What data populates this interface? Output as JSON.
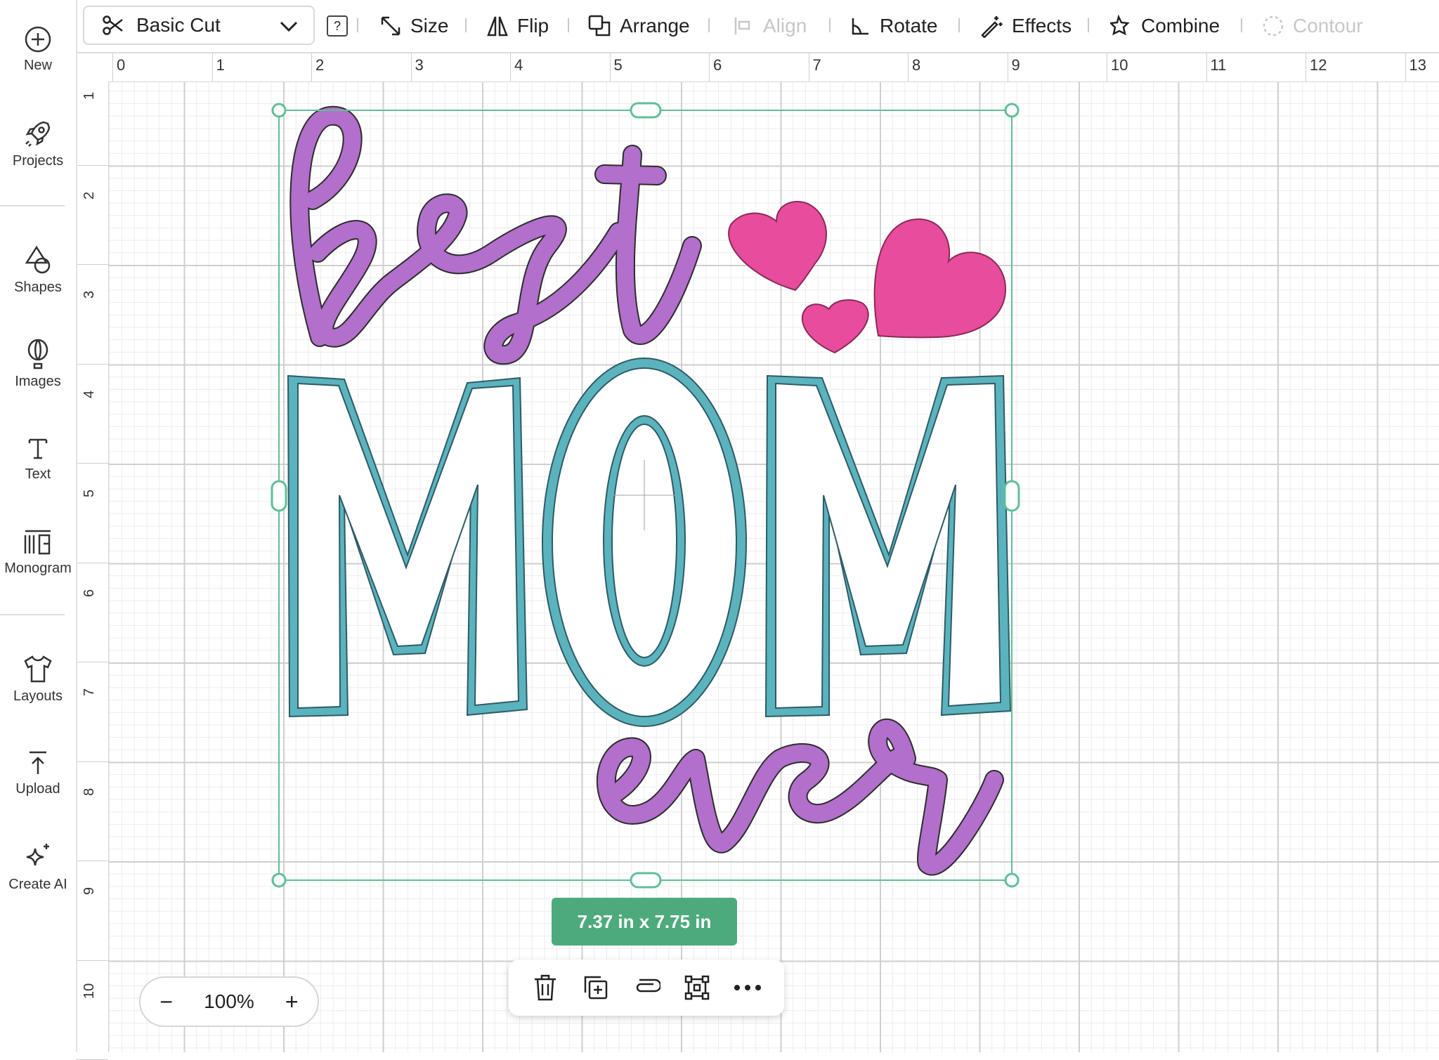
{
  "sidebar": {
    "items": [
      {
        "label": "New",
        "icon": "plus-circle-icon"
      },
      {
        "label": "Projects",
        "icon": "rocket-icon"
      },
      {
        "label": "Shapes",
        "icon": "shapes-icon"
      },
      {
        "label": "Images",
        "icon": "balloon-icon"
      },
      {
        "label": "Text",
        "icon": "text-icon"
      },
      {
        "label": "Monogram",
        "icon": "monogram-icon"
      },
      {
        "label": "Layouts",
        "icon": "shirt-icon"
      },
      {
        "label": "Upload",
        "icon": "upload-icon"
      },
      {
        "label": "Create AI",
        "icon": "sparkle-icon"
      }
    ]
  },
  "toolbar": {
    "cut_type": "Basic Cut",
    "help": "?",
    "size": "Size",
    "flip": "Flip",
    "arrange": "Arrange",
    "align": "Align",
    "rotate": "Rotate",
    "effects": "Effects",
    "combine": "Combine",
    "contour": "Contour"
  },
  "ruler": {
    "top": [
      "0",
      "1",
      "2",
      "3",
      "4",
      "5",
      "6",
      "7",
      "8",
      "9",
      "10",
      "11",
      "12",
      "13"
    ],
    "left": [
      "1",
      "2",
      "3",
      "4",
      "5",
      "6",
      "7",
      "8",
      "9",
      "10"
    ]
  },
  "design": {
    "word_best": "best",
    "word_mom": "MOM",
    "word_ever": "ever",
    "colors": {
      "script": "#b26fcb",
      "mom": "#5bb3bd",
      "hearts": "#e84c9c",
      "selection": "#5fbf94"
    }
  },
  "selection": {
    "size_label": "7.37  in x 7.75  in"
  },
  "context_bar": {
    "icons": [
      "trash-icon",
      "duplicate-icon",
      "attach-icon",
      "group-icon",
      "more-icon"
    ]
  },
  "zoom": {
    "minus": "−",
    "value": "100%",
    "plus": "+"
  }
}
